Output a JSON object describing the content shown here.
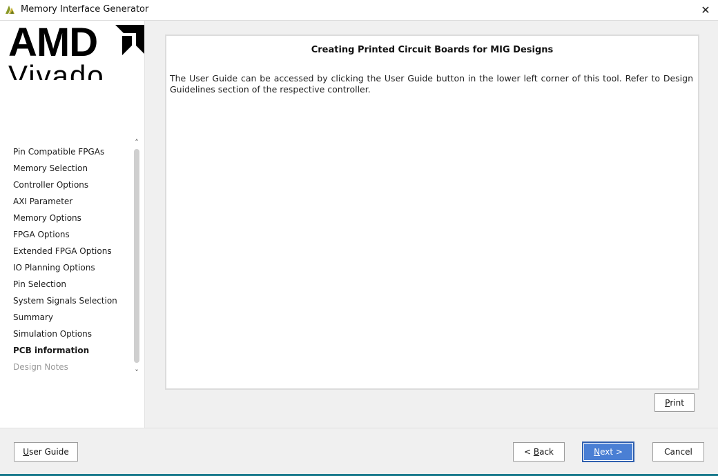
{
  "window": {
    "title": "Memory Interface Generator",
    "close_label": "✕"
  },
  "logo": {
    "brand": "AMD",
    "product": "Vivado"
  },
  "nav": {
    "items": [
      {
        "label": "Pin Compatible FPGAs",
        "state": "normal"
      },
      {
        "label": "Memory Selection",
        "state": "normal"
      },
      {
        "label": "Controller Options",
        "state": "normal"
      },
      {
        "label": "AXI Parameter",
        "state": "normal"
      },
      {
        "label": "Memory Options",
        "state": "normal"
      },
      {
        "label": "FPGA Options",
        "state": "normal"
      },
      {
        "label": "Extended FPGA Options",
        "state": "normal"
      },
      {
        "label": "IO Planning Options",
        "state": "normal"
      },
      {
        "label": "Pin Selection",
        "state": "normal"
      },
      {
        "label": "System Signals Selection",
        "state": "normal"
      },
      {
        "label": "Summary",
        "state": "normal"
      },
      {
        "label": "Simulation Options",
        "state": "normal"
      },
      {
        "label": "PCB information",
        "state": "active"
      },
      {
        "label": "Design Notes",
        "state": "disabled"
      }
    ],
    "scroll_up_icon": "chevron-up-icon",
    "scroll_down_icon": "chevron-down-icon"
  },
  "content": {
    "title": "Creating Printed Circuit Boards for MIG Designs",
    "body": "The User Guide can be accessed by clicking the User Guide button in the lower left corner of this tool. Refer to Design Guidelines section of the respective controller."
  },
  "buttons": {
    "print_mnemonic": "P",
    "print_rest": "rint",
    "guide_mnemonic": "U",
    "guide_rest": "ser Guide",
    "back_prefix": "< ",
    "back_mnemonic": "B",
    "back_rest": "ack",
    "next_mnemonic": "N",
    "next_rest": "ext >",
    "cancel": "Cancel"
  },
  "colors": {
    "accent": "#4a7fd4",
    "footer_bar": "#1a7a8c"
  }
}
